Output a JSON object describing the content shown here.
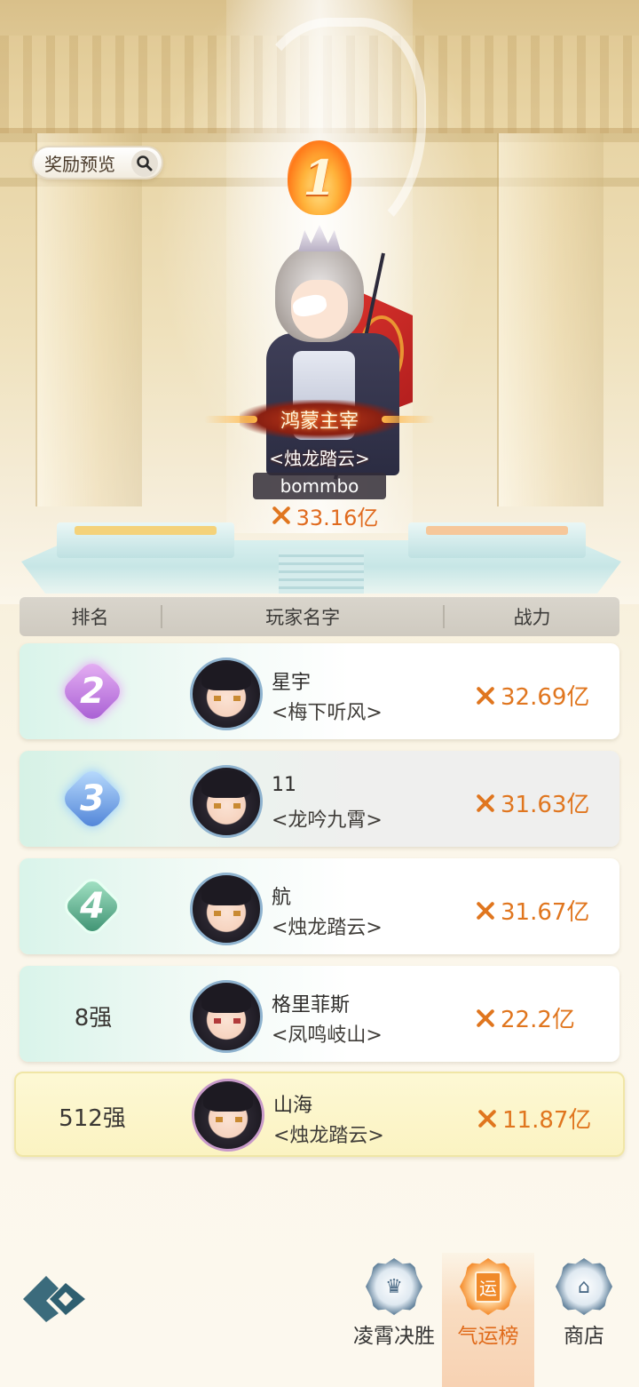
{
  "top": {
    "reward_preview_label": "奖励预览",
    "rank1_number": "1",
    "champion_title": "鸿蒙主宰",
    "champion_guild": "<烛龙踏云>",
    "champion_name": "bommbo",
    "champion_power": "33.16亿"
  },
  "table": {
    "headers": {
      "rank": "排名",
      "player": "玩家名字",
      "power": "战力"
    },
    "rows": [
      {
        "rank": "2",
        "name": "星宇",
        "guild": "<梅下听风>",
        "power": "32.69亿",
        "badge_color": "#b66ad8"
      },
      {
        "rank": "3",
        "name": "11",
        "guild": "<龙吟九霄>",
        "power": "31.63亿",
        "badge_color": "#4f86d8"
      },
      {
        "rank": "4",
        "name": "航",
        "guild": "<烛龙踏云>",
        "power": "31.67亿",
        "badge_color": "#3f9a78"
      },
      {
        "rank": "8强",
        "name": "格里菲斯",
        "guild": "<凤鸣岐山>",
        "power": "22.2亿"
      }
    ],
    "self_row": {
      "rank": "512强",
      "name": "山海",
      "guild": "<烛龙踏云>",
      "power": "11.87亿"
    }
  },
  "nav": {
    "tabs": [
      {
        "label": "凌霄决胜",
        "icon": "trophy-icon"
      },
      {
        "label": "气运榜",
        "icon": "fortune-icon",
        "glyph": "运",
        "active": true
      },
      {
        "label": "商店",
        "icon": "shop-icon"
      }
    ]
  },
  "colors": {
    "power_text": "#e0761f",
    "active_tab": "#e06a1a"
  }
}
